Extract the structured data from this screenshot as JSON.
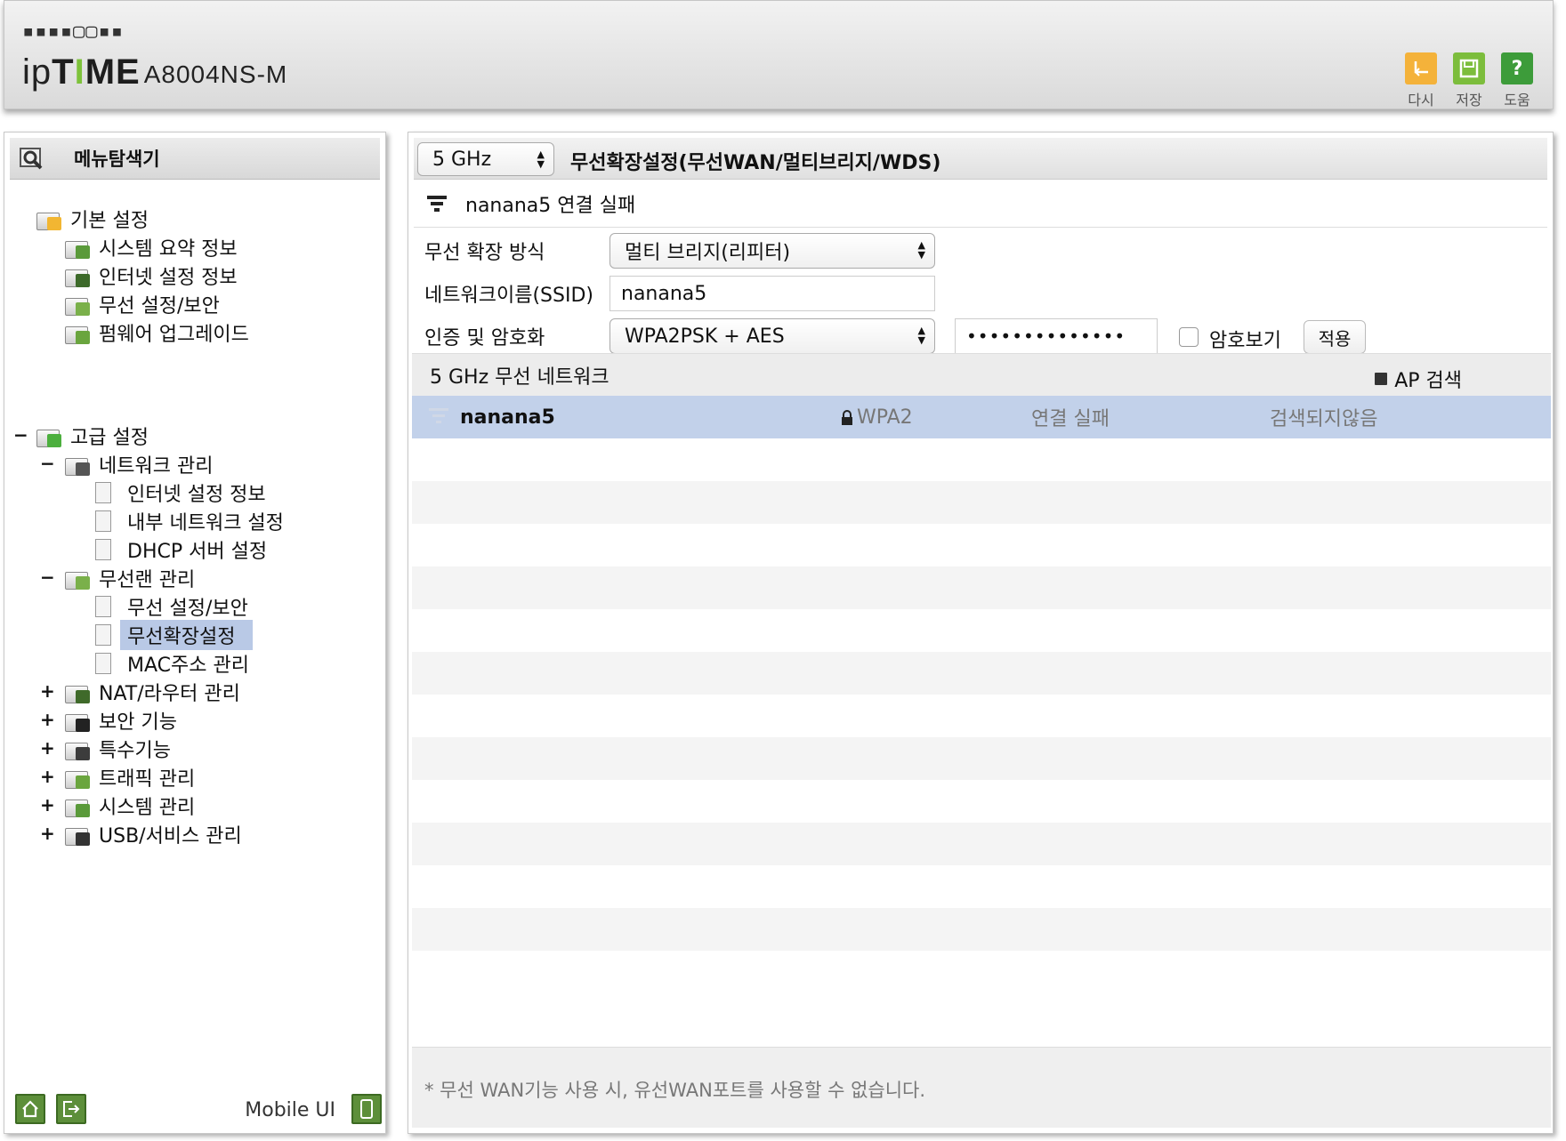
{
  "header": {
    "brand_dots": "▪▪▪▪▢▢▪▪",
    "brand_prefix": "ip",
    "brand_mid_t": "T",
    "brand_mid_i": "I",
    "brand_mid_me": "ME",
    "model": "A8004NS-M",
    "buttons": [
      {
        "label": "다시",
        "icon": "undo-icon",
        "color": "#f4b23a"
      },
      {
        "label": "저장",
        "icon": "save-icon",
        "color": "#7cbd3c"
      },
      {
        "label": "도움",
        "icon": "help-icon",
        "color": "#3d9c3a"
      }
    ]
  },
  "sidebar": {
    "title": "메뉴탐색기",
    "basic": {
      "label": "기본 설정",
      "items": [
        "시스템 요약 정보",
        "인터넷 설정 정보",
        "무선 설정/보안",
        "펌웨어 업그레이드"
      ]
    },
    "advanced": {
      "label": "고급 설정",
      "network": {
        "label": "네트워크 관리",
        "items": [
          "인터넷 설정 정보",
          "내부 네트워크 설정",
          "DHCP 서버 설정"
        ]
      },
      "wireless": {
        "label": "무선랜 관리",
        "items": [
          "무선 설정/보안",
          "무선확장설정",
          "MAC주소 관리"
        ]
      },
      "groups": [
        "NAT/라우터 관리",
        "보안 기능",
        "특수기능",
        "트래픽 관리",
        "시스템 관리",
        "USB/서비스 관리"
      ]
    },
    "footer": {
      "mobile_label": "Mobile UI"
    },
    "toggle_minus": "−",
    "toggle_plus": "+"
  },
  "main": {
    "band": "5 GHz",
    "title": "무선확장설정(무선WAN/멀티브리지/WDS)",
    "status": "nanana5 연결 실패",
    "form": {
      "mode_label": "무선 확장 방식",
      "mode_value": "멀티 브리지(리피터)",
      "ssid_label": "네트워크이름(SSID)",
      "ssid_value": "nanana5",
      "auth_label": "인증 및 암호화",
      "auth_value": "WPA2PSK + AES",
      "password_mask": "••••••••••••••",
      "show_pw_label": "암호보기",
      "apply_label": "적용"
    },
    "network_list": {
      "title": "5 GHz 무선 네트워크",
      "ap_scan_label": "AP 검색",
      "rows": [
        {
          "ssid": "nanana5",
          "security": "WPA2",
          "status": "연결 실패",
          "signal": "검색되지않음"
        }
      ]
    },
    "footnote": "* 무선 WAN기능 사용 시, 유선WAN포트를 사용할 수 없습니다."
  }
}
